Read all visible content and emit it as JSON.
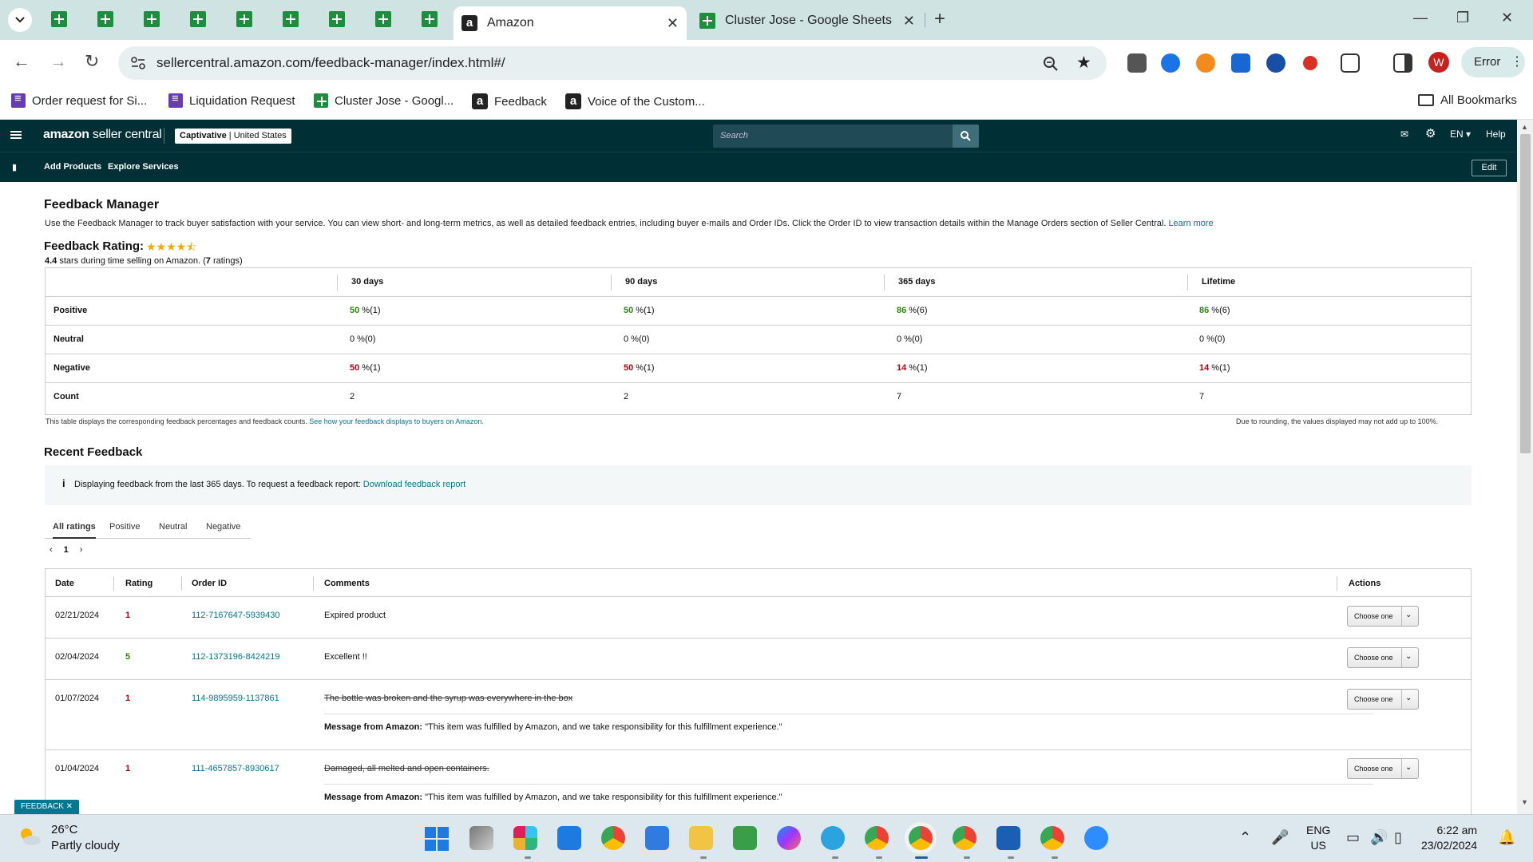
{
  "browser": {
    "active_tab_title": "Amazon",
    "second_tab_title": "Cluster Jose - Google Sheets",
    "url": "sellercentral.amazon.com/feedback-manager/index.html#/",
    "profile_initial": "W",
    "error_label": "Error",
    "bookmarks": [
      {
        "label": "Order request for Si...",
        "icon": "google-forms-icon"
      },
      {
        "label": "Liquidation Request",
        "icon": "google-forms-icon"
      },
      {
        "label": "Cluster Jose - Googl...",
        "icon": "google-sheets-icon"
      },
      {
        "label": "Feedback",
        "icon": "amazon-icon"
      },
      {
        "label": "Voice of the Custom...",
        "icon": "amazon-icon"
      }
    ],
    "all_bookmarks_label": "All Bookmarks"
  },
  "seller_central": {
    "logo_bold": "amazon",
    "logo_rest": " seller central",
    "store_name": "Captivative",
    "store_sep": " | ",
    "store_region": "United States",
    "search_placeholder": "Search",
    "language": "EN",
    "help": "Help",
    "sub_links": [
      "Add Products",
      "Explore Services"
    ],
    "edit_label": "Edit"
  },
  "page": {
    "title": "Feedback Manager",
    "intro": "Use the Feedback Manager to track buyer satisfaction with your service. You can view short- and long-term metrics, as well as detailed feedback entries, including buyer e-mails and Order IDs. Click the Order ID to view transaction details within the Manage Orders section of Seller Central. ",
    "learn_more": "Learn more",
    "rating_title": "Feedback Rating:",
    "stars": "★★★★⯪",
    "rating_value": "4.4",
    "rating_text": " stars during time selling on Amazon. (",
    "rating_count": "7",
    "rating_suffix": " ratings)"
  },
  "metrics": {
    "columns": [
      "30 days",
      "90 days",
      "365 days",
      "Lifetime"
    ],
    "rows": [
      {
        "label": "Positive",
        "values": [
          [
            "50",
            " %(1)"
          ],
          [
            "50",
            " %(1)"
          ],
          [
            "86",
            " %(6)"
          ],
          [
            "86",
            " %(6)"
          ]
        ],
        "tone": "green"
      },
      {
        "label": "Neutral",
        "values": [
          [
            "0",
            " %(0)"
          ],
          [
            "0",
            " %(0)"
          ],
          [
            "0",
            " %(0)"
          ],
          [
            "0",
            " %(0)"
          ]
        ],
        "tone": "plain"
      },
      {
        "label": "Negative",
        "values": [
          [
            "50",
            " %(1)"
          ],
          [
            "50",
            " %(1)"
          ],
          [
            "14",
            " %(1)"
          ],
          [
            "14",
            " %(1)"
          ]
        ],
        "tone": "red"
      },
      {
        "label": "Count",
        "values": [
          [
            "2",
            ""
          ],
          [
            "2",
            ""
          ],
          [
            "7",
            ""
          ],
          [
            "7",
            ""
          ]
        ],
        "tone": "plain"
      }
    ],
    "note_left": "This table displays the corresponding feedback percentages and feedback counts. ",
    "note_left_link": "See how your feedback displays to buyers on Amazon.",
    "note_right": "Due to rounding, the values displayed may not add up to 100%."
  },
  "recent": {
    "title": "Recent Feedback",
    "info_text": "Displaying feedback from the last 365 days. To request a feedback report: ",
    "info_link": "Download feedback report",
    "tabs": [
      "All ratings",
      "Positive",
      "Neutral",
      "Negative"
    ],
    "page_number": "1",
    "headers": [
      "Date",
      "Rating",
      "Order ID",
      "Comments",
      "Actions"
    ],
    "rows": [
      {
        "date": "02/21/2024",
        "rating": "1",
        "order_id": "112-7167647-5939430",
        "comment": "Expired product",
        "struck": false,
        "message": ""
      },
      {
        "date": "02/04/2024",
        "rating": "5",
        "order_id": "112-1373196-8424219",
        "comment": "Excellent !!",
        "struck": false,
        "message": ""
      },
      {
        "date": "01/07/2024",
        "rating": "1",
        "order_id": "114-9895959-1137861",
        "comment": "The bottle was broken and the syrup was everywhere in the box",
        "struck": true,
        "message": "\"This item was fulfilled by Amazon, and we take responsibility for this fulfillment experience.\""
      },
      {
        "date": "01/04/2024",
        "rating": "1",
        "order_id": "111-4657857-8930617",
        "comment": "Damaged, all melted and open containers.",
        "struck": true,
        "message": "\"This item was fulfilled by Amazon, and we take responsibility for this fulfillment experience.\""
      }
    ],
    "message_label": "Message from Amazon: ",
    "action_label": "Choose one"
  },
  "feedback_tab": "FEEDBACK ✕",
  "taskbar": {
    "temperature": "26°C",
    "weather": "Partly cloudy",
    "lang_line1": "ENG",
    "lang_line2": "US",
    "time": "6:22 am",
    "date": "23/02/2024"
  },
  "colors": {
    "nav_bg": "#002f36",
    "link": "#00788f",
    "positive": "#2a8a00",
    "negative": "#b10012"
  }
}
